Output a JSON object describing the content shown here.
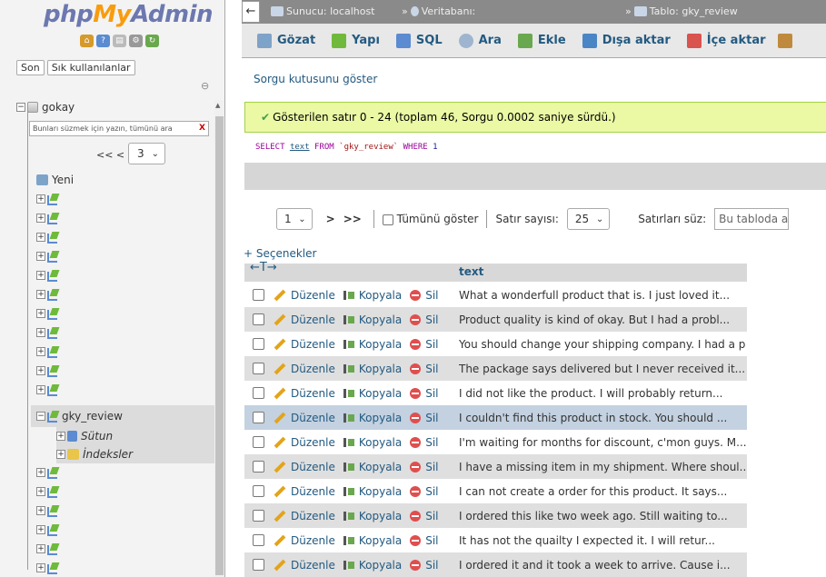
{
  "nav": {
    "logo_php": "php",
    "logo_my": "My",
    "logo_admin": "Admin",
    "icons": [
      "home-icon",
      "help-icon",
      "docs-icon",
      "settings-icon",
      "reload-icon"
    ],
    "tabs": [
      "Son",
      "Sık kullanılanlar"
    ],
    "database": "gokay",
    "filter_placeholder": "Bunları süzmek için yazın, tümünü ara",
    "filter_clear": "X",
    "pager_prev": "<< <",
    "pager_value": "3",
    "new_label": "Yeni",
    "table_name": "gky_review",
    "columns_label": "Sütun",
    "indexes_label": "İndeksler"
  },
  "topbar": {
    "server": "Sunucu: localhost",
    "database": "Veritabanı:",
    "table": "Tablo: gky_review"
  },
  "tabs": [
    {
      "label": "Gözat",
      "icon": "browse-icon",
      "color": "#7ea3c9"
    },
    {
      "label": "Yapı",
      "icon": "structure-icon",
      "color": "#6fba3c"
    },
    {
      "label": "SQL",
      "icon": "sql-icon",
      "color": "#5b8bd0"
    },
    {
      "label": "Ara",
      "icon": "search-icon",
      "color": "#9fb5cf"
    },
    {
      "label": "Ekle",
      "icon": "insert-icon",
      "color": "#6aa84f"
    },
    {
      "label": "Dışa aktar",
      "icon": "export-icon",
      "color": "#4a86c5"
    },
    {
      "label": "İçe aktar",
      "icon": "import-icon",
      "color": "#d9534f"
    }
  ],
  "main": {
    "show_query": "Sorgu kutusunu göster",
    "success_msg": "Gösterilen satır 0 - 24 (toplam 46, Sorgu 0.0002 saniye sürdü.)",
    "sql": {
      "select": "SELECT",
      "col": "text",
      "from": "FROM",
      "table": "`gky_review`",
      "where": "WHERE",
      "num": "1"
    },
    "page_select": "1",
    "next": ">",
    "last": ">>",
    "show_all": "Tümünü göster",
    "row_count_label": "Satır sayısı:",
    "row_count_value": "25",
    "filter_label": "Satırları süz:",
    "filter_placeholder": "Bu tabloda ara",
    "options": "+ Seçenekler",
    "resize_arrows": "←T→",
    "column_header": "text",
    "edit": "Düzenle",
    "copy": "Kopyala",
    "delete": "Sil"
  },
  "rows": [
    "What a wonderfull product that is. I just loved it...",
    "Product quality is kind of okay. But I had a probl...",
    "You should change your shipping company. I had a p...",
    "The package says delivered but I never received it...",
    "I did not like the product. I will probably return...",
    "I couldn't find this product in stock. You should ...",
    "I'm waiting for months for discount, c'mon guys. M...",
    "I have a missing item in my shipment.  Where shoul...",
    "I can not create a order for this product. It says...",
    "I ordered this like two week ago. Still waiting to...",
    "It has not the quailty I expected it. I will retur...",
    "I ordered it and it took a week to arrive. Cause i..."
  ]
}
